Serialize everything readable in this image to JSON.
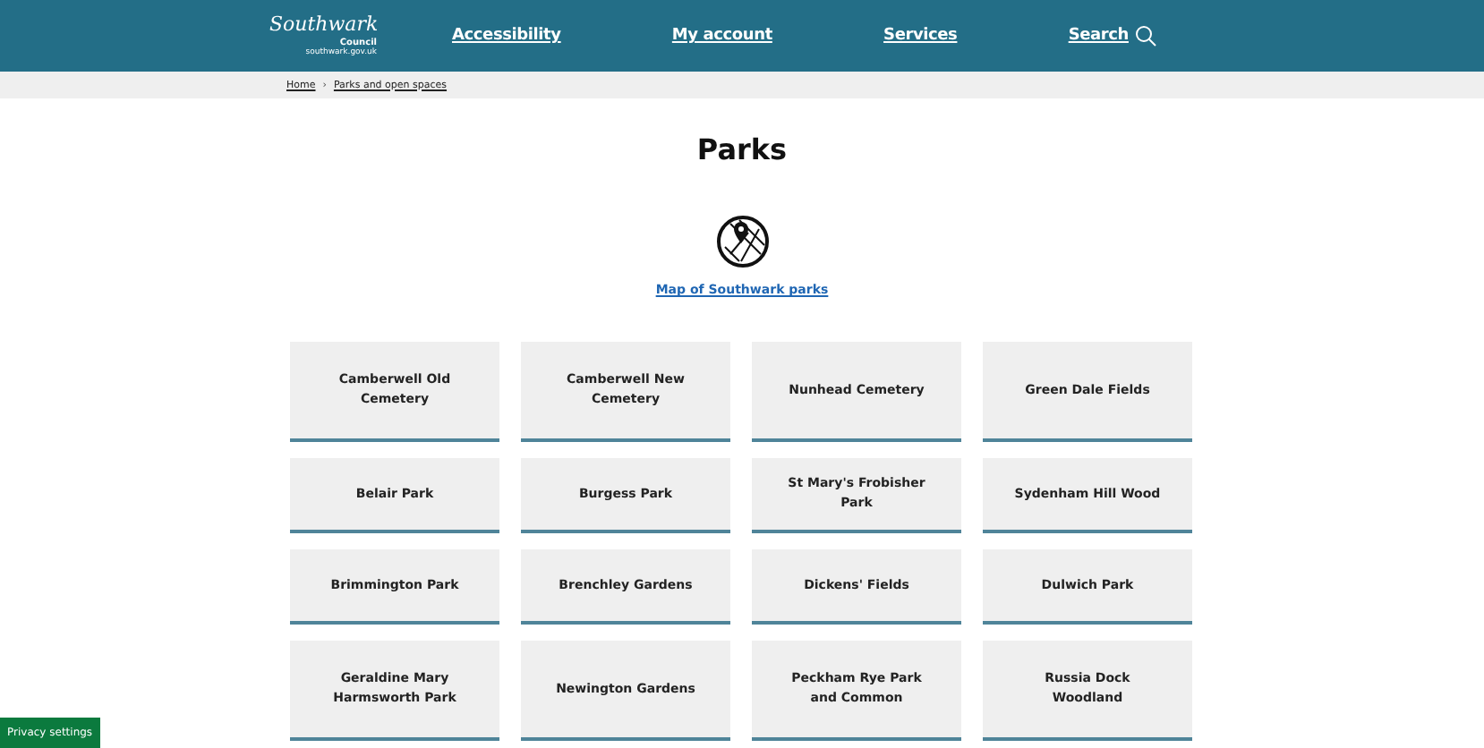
{
  "header": {
    "logo": {
      "name": "Southwark",
      "subtitle": "Council",
      "url": "southwark.gov.uk"
    },
    "nav": [
      {
        "label": "Accessibility",
        "kind": "link"
      },
      {
        "label": "My account",
        "kind": "link"
      },
      {
        "label": "Services",
        "kind": "link"
      },
      {
        "label": "Search",
        "kind": "search"
      }
    ]
  },
  "breadcrumb": [
    {
      "label": "Home"
    },
    {
      "label": "Parks and open spaces"
    }
  ],
  "breadcrumb_separator": "›",
  "title": "Parks",
  "map_link": "Map of Southwark parks",
  "parks": [
    {
      "name": "Camberwell Old Cemetery"
    },
    {
      "name": "Camberwell New Cemetery"
    },
    {
      "name": "Nunhead Cemetery"
    },
    {
      "name": "Green Dale Fields"
    },
    {
      "name": "Belair Park"
    },
    {
      "name": "Burgess Park"
    },
    {
      "name": "St Mary's Frobisher Park"
    },
    {
      "name": "Sydenham Hill Wood"
    },
    {
      "name": "Brimmington Park"
    },
    {
      "name": "Brenchley Gardens"
    },
    {
      "name": "Dickens' Fields"
    },
    {
      "name": "Dulwich Park"
    },
    {
      "name": "Geraldine Mary Harmsworth Park"
    },
    {
      "name": "Newington Gardens"
    },
    {
      "name": "Peckham Rye Park and Common"
    },
    {
      "name": "Russia Dock Woodland"
    }
  ],
  "privacy_button": "Privacy settings"
}
